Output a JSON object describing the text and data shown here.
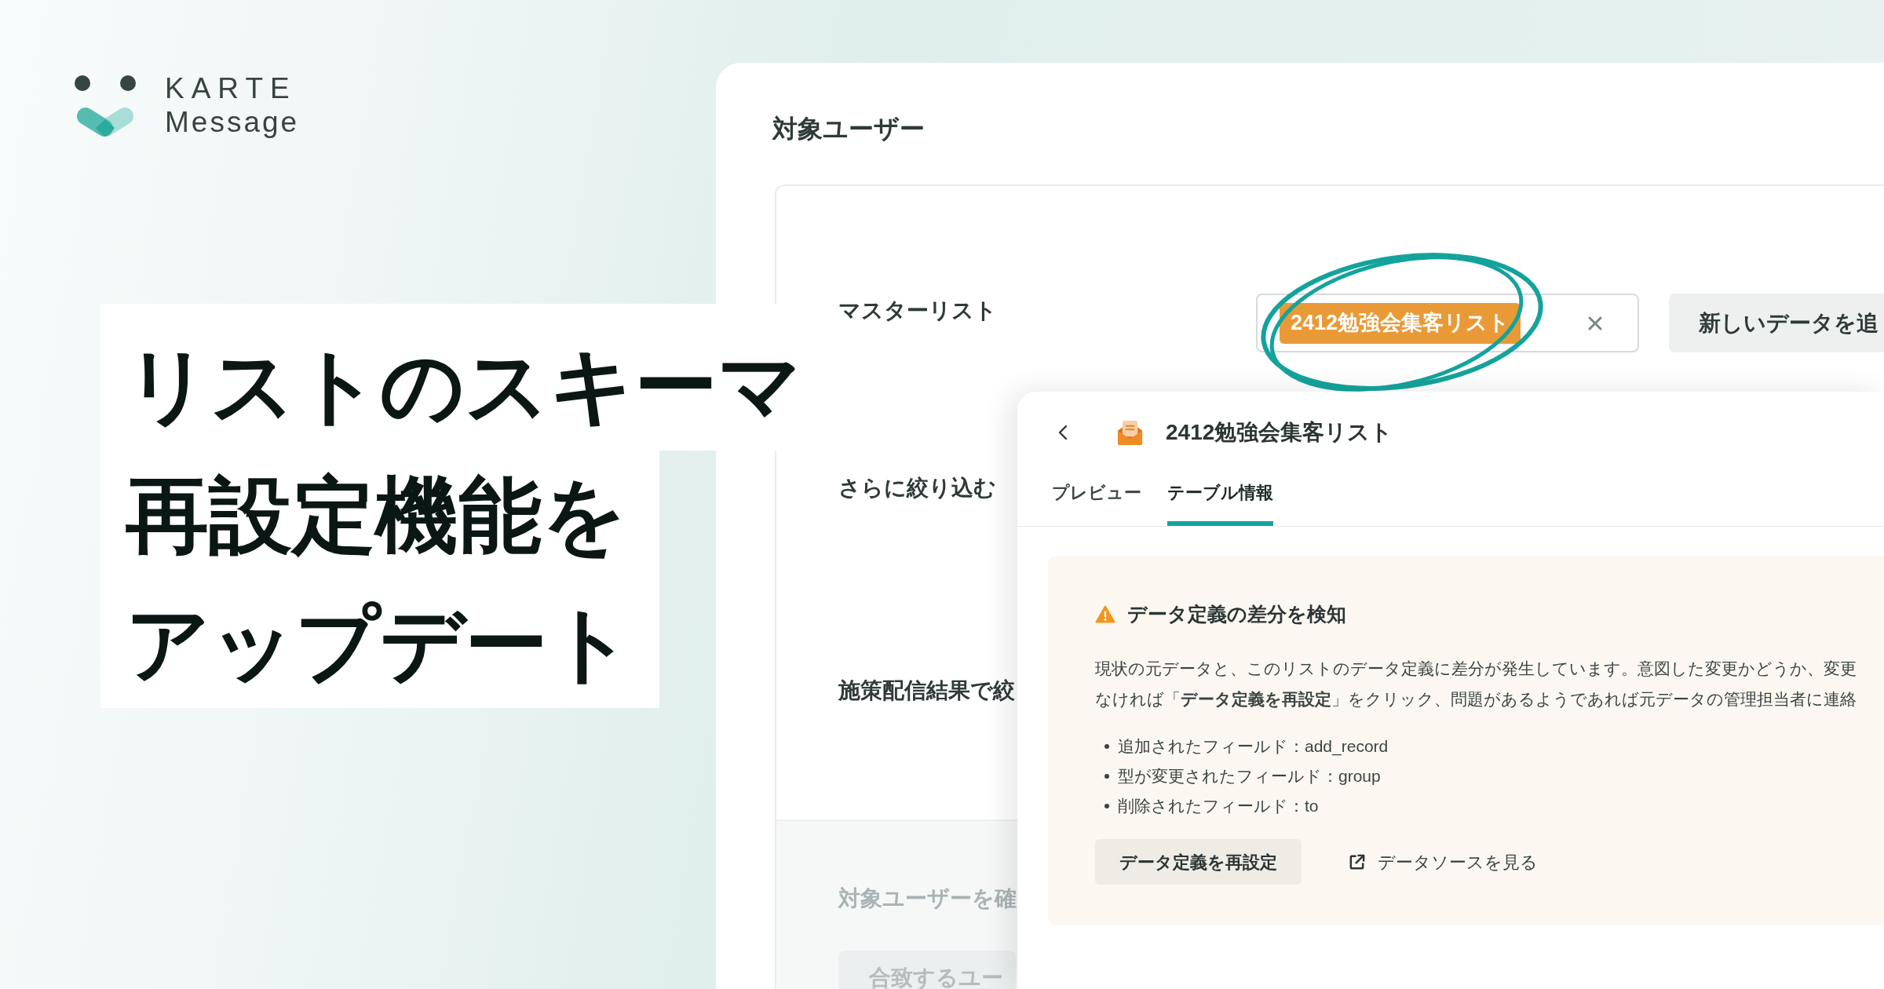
{
  "brand": {
    "name": "KARTE",
    "product": "Message"
  },
  "headline": {
    "lines": [
      "リストのスキーマ",
      "再設定機能を",
      "アップデート"
    ]
  },
  "panel": {
    "title": "対象ユーザー",
    "rows": [
      {
        "kind": "select",
        "label": "マスターリスト",
        "tag": "2412勉強会集客リスト",
        "highlighted": true,
        "button": "新しいデータを追"
      },
      {
        "kind": "label",
        "label": "さらに絞り込む"
      },
      {
        "kind": "label",
        "label": "施策配信結果で絞"
      }
    ],
    "footer": {
      "label": "対象ユーザーを確",
      "button": "合致するユー",
      "disabled": true
    }
  },
  "drawer": {
    "title": "2412勉強会集客リスト",
    "tabs": [
      {
        "label": "プレビュー",
        "selected": false
      },
      {
        "label": "テーブル情報",
        "selected": true
      }
    ],
    "alert": {
      "title": "データ定義の差分を検知",
      "message_lines": [
        "現状の元データと、このリストのデータ定義に差分が発生しています。意図した変更かどうか、変更",
        "なければ「**データ定義を再設定**」をクリック、問題があるようであれば元データの管理担当者に連絡"
      ],
      "items": [
        "追加されたフィールド：add_record",
        "型が変更されたフィールド：group",
        "削除されたフィールド：to"
      ],
      "button": "データ定義を再設定",
      "link": "データソースを見る"
    }
  }
}
